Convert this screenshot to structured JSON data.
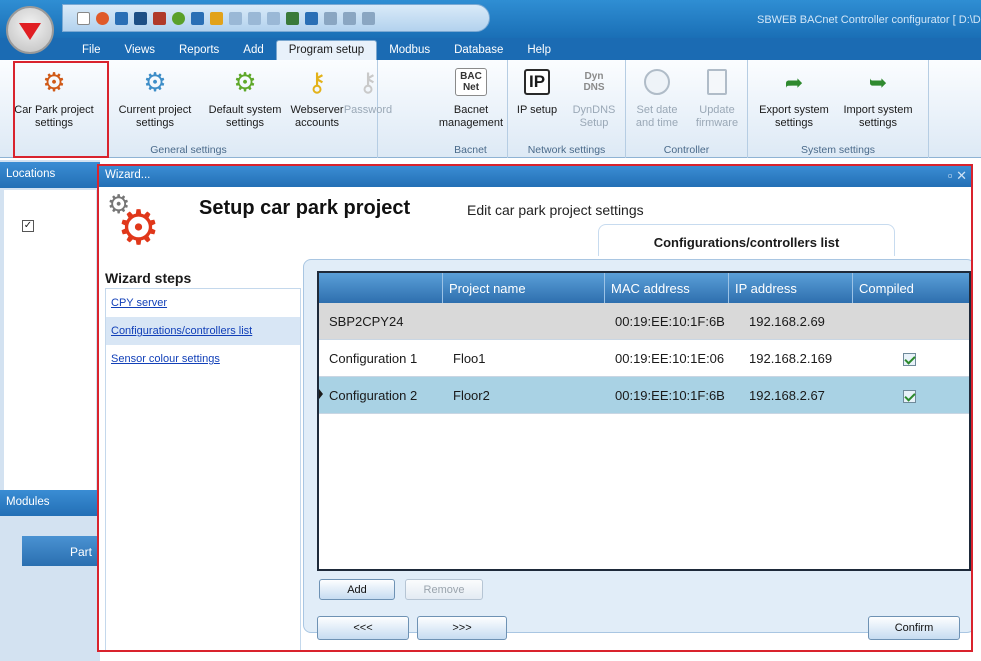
{
  "app": {
    "title": "SBWEB BACnet Controller configurator [ D:\\D"
  },
  "menu": {
    "tabs": [
      "File",
      "Views",
      "Reports",
      "Add",
      "Program setup",
      "Modbus",
      "Database",
      "Help"
    ],
    "active": "Program setup"
  },
  "ribbon": {
    "general": {
      "label": "General settings",
      "car_park": "Car Park project settings",
      "current_project": "Current project settings",
      "default_system": "Default system settings",
      "webserver": "Webserver accounts",
      "password": "Password"
    },
    "bacnet": {
      "label": "Bacnet",
      "icon_text": "BAC Net",
      "management": "Bacnet management"
    },
    "network": {
      "label": "Network settings",
      "ip_icon": "IP",
      "ip": "IP setup",
      "dyn_icon": "Dyn DNS",
      "dyndns": "DynDNS Setup"
    },
    "controller": {
      "label": "Controller",
      "set_date": "Set date and time",
      "update": "Update firmware"
    },
    "system": {
      "label": "System settings",
      "export": "Export system settings",
      "import": "Import system settings"
    }
  },
  "panels": {
    "locations": "Locations",
    "modules": "Modules",
    "part": "Part"
  },
  "wizard": {
    "title_bar": "Wizard...",
    "heading": "Setup car park project",
    "subheading": "Edit car park project settings",
    "tab": "Configurations/controllers list",
    "steps_header": "Wizard steps",
    "steps": [
      "CPY server",
      "Configurations/controllers list",
      "Sensor colour settings"
    ],
    "selected_step": 1,
    "table": {
      "columns": [
        "",
        "Project name",
        "MAC address",
        "IP address",
        "Compiled"
      ],
      "rows": [
        {
          "name": "SBP2CPY24",
          "project": "",
          "mac": "00:19:EE:10:1F:6B",
          "ip": "192.168.2.69",
          "compiled": false
        },
        {
          "name": "Configuration 1",
          "project": "Floo1",
          "mac": "00:19:EE:10:1E:06",
          "ip": "192.168.2.169",
          "compiled": true
        },
        {
          "name": "Configuration 2",
          "project": "Floor2",
          "mac": "00:19:EE:10:1F:6B",
          "ip": "192.168.2.67",
          "compiled": true
        }
      ]
    },
    "buttons": {
      "add": "Add",
      "remove": "Remove",
      "prev": "<<<",
      "next": ">>>",
      "confirm": "Confirm"
    }
  }
}
